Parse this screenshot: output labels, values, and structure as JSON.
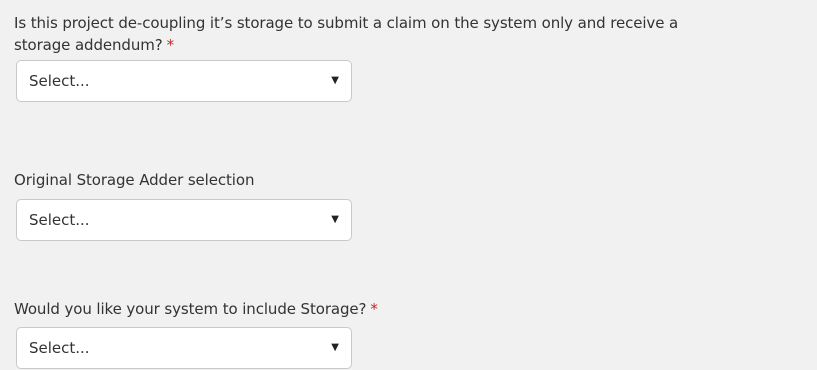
{
  "form": {
    "fields": [
      {
        "label_line1": "Is this project de-coupling it’s storage to submit a claim on the system only and receive a",
        "label_line2": "storage addendum?",
        "required_marker": "*",
        "select_value": "Select...",
        "caret_icon": "caret-down-icon"
      },
      {
        "label": "Original Storage Adder selection",
        "select_value": "Select...",
        "caret_icon": "caret-down-icon"
      },
      {
        "label": "Would you like your system to include Storage?",
        "required_marker": "*",
        "select_value": "Select...",
        "caret_icon": "caret-down-icon"
      }
    ]
  },
  "colors": {
    "background": "#f1f1f1",
    "required": "#cc2222",
    "text": "#333333"
  }
}
